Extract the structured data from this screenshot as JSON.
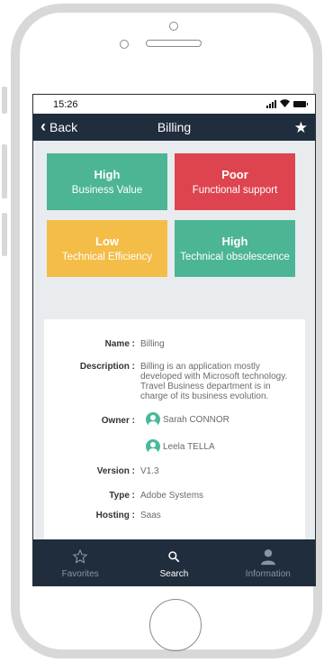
{
  "status_bar": {
    "time": "15:26"
  },
  "nav": {
    "back_label": "Back",
    "title": "Billing",
    "favorite_icon": "star-icon"
  },
  "tiles": [
    {
      "level": "High",
      "label": "Business Value",
      "color": "#4cb596"
    },
    {
      "level": "Poor",
      "label": "Functional support",
      "color": "#de4450"
    },
    {
      "level": "Low",
      "label": "Technical Efficiency",
      "color": "#f3bd47"
    },
    {
      "level": "High",
      "label": "Technical obsolescence",
      "color": "#4cb596"
    }
  ],
  "details": {
    "name_key": "Name :",
    "name_value": "Billing",
    "description_key": "Description :",
    "description_value": "Billing is an application mostly developed with Microsoft technology.",
    "description_value_2": "Travel Business department is in charge of its business evolution.",
    "owner_key": "Owner :",
    "owners": [
      "Sarah CONNOR",
      "Leela TELLA"
    ],
    "version_key": "Version :",
    "version_value": "V1.3",
    "type_key": "Type :",
    "type_value": "Adobe Systems",
    "hosting_key": "Hosting :",
    "hosting_value": "Saas"
  },
  "tab_bar": [
    {
      "label": "Favorites",
      "icon": "star-outline-icon",
      "active": false
    },
    {
      "label": "Search",
      "icon": "search-icon",
      "active": true
    },
    {
      "label": "Information",
      "icon": "user-icon",
      "active": false
    }
  ],
  "colors": {
    "nav_background": "#1f2d3d",
    "screen_background": "#e9ecef",
    "accent_green": "#4cb596"
  }
}
